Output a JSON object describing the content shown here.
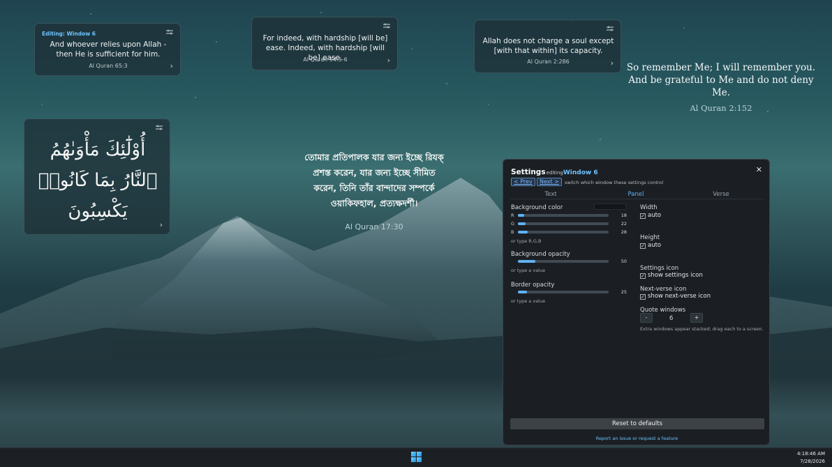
{
  "cards": [
    {
      "editing_label": "Editing: Window 6",
      "verse": "And whoever relies upon Allah - then He is sufficient for him.",
      "ref": "Al Quran 65:3"
    },
    {
      "verse": "For indeed, with hardship [will be] ease. Indeed, with hardship [will be] ease.",
      "ref": "Al Quran 94:5-6"
    },
    {
      "verse": "Allah does not charge a soul except [with that within] its capacity.",
      "ref": "Al Quran 2:286"
    },
    {
      "arabic": "أُوْلَٰٓئِكَ مَأْوَىٰهُمُ ٱلنَّارُ بِمَا كَانُوا۟ يَكْسِبُونَ"
    }
  ],
  "float_english": {
    "verse": "So remember Me; I will remember you. And be grateful to Me and do not deny Me.",
    "ref": "Al Quran 2:152"
  },
  "float_bangla": {
    "verse": "তোমার প্রতিপালক যার জন্য ইচ্ছে রিযক্ প্রশস্ত করেন, যার জন্য ইচ্ছে সীমিত করেন, তিনি তাঁর বান্দাদের সম্পর্কে ওয়াকিফহাল, প্রত্যক্ষদর্শী।",
    "ref": "Al Quran 17:30"
  },
  "settings": {
    "title": "Settings",
    "editing_word": "editing",
    "window_name": "Window 6",
    "prev_label": "< Prev",
    "next_label": "Next >",
    "hint": "switch which window these settings control",
    "tabs": [
      "Text",
      "Panel",
      "Verse"
    ],
    "active_tab": "Panel",
    "bg_color_label": "Background color",
    "rgb": [
      {
        "label": "R",
        "value": 18
      },
      {
        "label": "G",
        "value": 22
      },
      {
        "label": "B",
        "value": 28
      }
    ],
    "rgb_hint": "or type R,G,B",
    "bg_opacity_label": "Background opacity",
    "bg_opacity_value": 50,
    "type_value_hint": "or type a value",
    "border_opacity_label": "Border opacity",
    "border_opacity_value": 25,
    "width_label": "Width",
    "width_check": "auto",
    "height_label": "Height",
    "height_check": "auto",
    "settings_icon_label": "Settings icon",
    "settings_icon_check": "show settings icon",
    "next_verse_label": "Next-verse icon",
    "next_verse_check": "show next-verse icon",
    "quote_windows_label": "Quote windows",
    "quote_windows_value": "6",
    "minus_label": "-",
    "plus_label": "+",
    "quote_windows_hint": "Extra windows appear stacked; drag each to a screen.",
    "reset_label": "Reset to defaults",
    "report_label": "Report an issue or request a feature",
    "close_glyph": "✕"
  },
  "taskbar": {
    "time": "4:18:46 AM",
    "date": "7/28/2026",
    "start_icon": "windows-logo-icon"
  },
  "colors": {
    "accent": "#5fb2f5",
    "link": "#6ec3ff",
    "panel_bg": "#1b1f24"
  },
  "icons": {
    "card_settings": "settings-icon",
    "card_next": "chevron-right-icon"
  }
}
